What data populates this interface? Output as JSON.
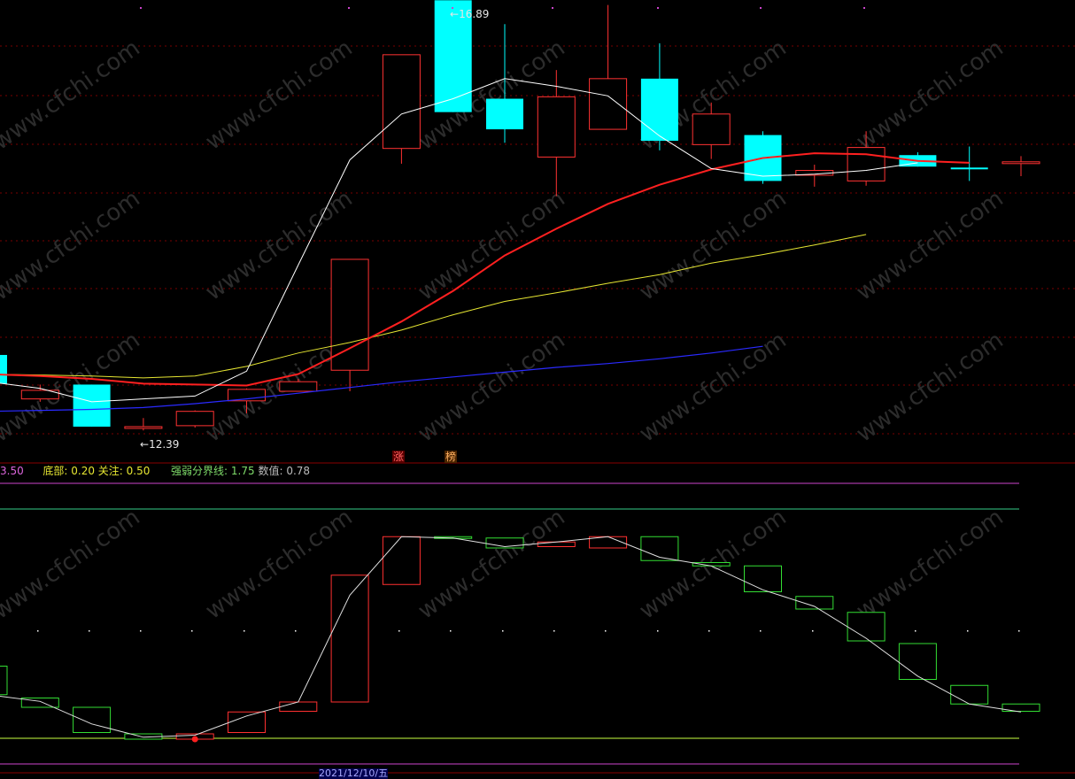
{
  "colors": {
    "background": "#000000",
    "grid": "#7a0000",
    "up": "#ff3232",
    "down": "#00ffff",
    "ma5": "#ffffff",
    "ma10": "#ff2020",
    "ma20": "#e6e632",
    "ma60": "#2a2aff",
    "osc_up": "#ff3030",
    "osc_down": "#33dd33",
    "line_pink": "#cc44cc",
    "line_green": "#33cc88",
    "line_yellow": "#c8ff40"
  },
  "price_panel": {
    "high_marker": "16.89",
    "low_marker": "12.39",
    "badge_zhang": "涨",
    "badge_bang": "榜"
  },
  "indicator_panel": {
    "partial_value": "3.50",
    "bottom_label": "底部:",
    "bottom_value": "0.20",
    "focus_label": "关注:",
    "focus_value": "0.50",
    "divider_label": "强弱分界线:",
    "divider_value": "1.75",
    "value_label": "数值:",
    "value_value": "0.78"
  },
  "date_label": "2021/12/10/五",
  "watermark": "www.cfchi.com",
  "chart_data": {
    "type": "candlestick",
    "candles": [
      {
        "o": 13.18,
        "h": 13.25,
        "l": 12.78,
        "c": 12.88
      },
      {
        "o": 12.72,
        "h": 12.87,
        "l": 12.69,
        "c": 12.81
      },
      {
        "o": 12.87,
        "h": 12.87,
        "l": 12.43,
        "c": 12.43
      },
      {
        "o": 12.43,
        "h": 12.52,
        "l": 12.39,
        "c": 12.43
      },
      {
        "o": 12.44,
        "h": 12.6,
        "l": 12.42,
        "c": 12.59
      },
      {
        "o": 12.7,
        "h": 12.83,
        "l": 12.57,
        "c": 12.82
      },
      {
        "o": 12.8,
        "h": 12.93,
        "l": 12.8,
        "c": 12.9
      },
      {
        "o": 13.02,
        "h": 14.18,
        "l": 12.8,
        "c": 14.18
      },
      {
        "o": 15.34,
        "h": 16.32,
        "l": 15.18,
        "c": 16.32
      },
      {
        "o": 16.89,
        "h": 16.89,
        "l": 15.72,
        "c": 15.72
      },
      {
        "o": 15.86,
        "h": 16.64,
        "l": 15.4,
        "c": 15.54
      },
      {
        "o": 15.25,
        "h": 16.16,
        "l": 14.84,
        "c": 15.88
      },
      {
        "o": 15.54,
        "h": 16.84,
        "l": 15.54,
        "c": 16.07
      },
      {
        "o": 16.07,
        "h": 16.44,
        "l": 15.32,
        "c": 15.42
      },
      {
        "o": 15.38,
        "h": 15.82,
        "l": 15.23,
        "c": 15.7
      },
      {
        "o": 15.48,
        "h": 15.52,
        "l": 14.97,
        "c": 15.0
      },
      {
        "o": 15.06,
        "h": 15.17,
        "l": 14.94,
        "c": 15.11
      },
      {
        "o": 15.0,
        "h": 15.52,
        "l": 14.95,
        "c": 15.35
      },
      {
        "o": 15.27,
        "h": 15.3,
        "l": 15.15,
        "c": 15.15
      },
      {
        "o": 15.14,
        "h": 15.36,
        "l": 15.0,
        "c": 15.13
      },
      {
        "o": 15.19,
        "h": 15.26,
        "l": 15.05,
        "c": 15.2
      }
    ],
    "ma5": [
      12.9,
      12.83,
      12.69,
      12.72,
      12.75,
      13.01,
      14.12,
      15.22,
      15.7,
      15.86,
      16.07,
      15.99,
      15.89,
      15.47,
      15.13,
      15.05,
      15.07,
      15.11,
      15.19
    ],
    "ma10": [
      12.98,
      12.96,
      12.93,
      12.88,
      12.87,
      12.86,
      12.98,
      13.25,
      13.53,
      13.85,
      14.22,
      14.5,
      14.76,
      14.96,
      15.12,
      15.24,
      15.29,
      15.28,
      15.21,
      15.19
    ],
    "ma20": [
      12.98,
      12.97,
      12.96,
      12.94,
      12.96,
      13.06,
      13.2,
      13.31,
      13.44,
      13.6,
      13.74,
      13.83,
      13.93,
      14.02,
      14.14,
      14.23,
      14.33,
      14.44
    ],
    "ma60": [
      12.59,
      12.6,
      12.61,
      12.63,
      12.67,
      12.72,
      12.78,
      12.84,
      12.9,
      12.95,
      13.0,
      13.05,
      13.09,
      13.14,
      13.2,
      13.27
    ],
    "oscillator": {
      "bars": [
        {
          "o": 1.55,
          "c": 1.12
        },
        {
          "o": 1.07,
          "c": 0.93
        },
        {
          "o": 0.93,
          "c": 0.55
        },
        {
          "o": 0.53,
          "c": 0.45
        },
        {
          "o": 0.45,
          "c": 0.53
        },
        {
          "o": 0.55,
          "c": 0.86
        },
        {
          "o": 0.87,
          "c": 1.01
        },
        {
          "o": 1.01,
          "c": 2.92
        },
        {
          "o": 2.78,
          "c": 3.5
        },
        {
          "o": 3.5,
          "c": 3.48
        },
        {
          "o": 3.48,
          "c": 3.33
        },
        {
          "o": 3.35,
          "c": 3.42
        },
        {
          "o": 3.33,
          "c": 3.5
        },
        {
          "o": 3.5,
          "c": 3.14
        },
        {
          "o": 3.11,
          "c": 3.06
        },
        {
          "o": 3.06,
          "c": 2.67
        },
        {
          "o": 2.6,
          "c": 2.41
        },
        {
          "o": 2.36,
          "c": 1.93
        },
        {
          "o": 1.89,
          "c": 1.35
        },
        {
          "o": 1.26,
          "c": 0.98
        },
        {
          "o": 0.98,
          "c": 0.87
        }
      ],
      "line": [
        1.12,
        1.02,
        0.68,
        0.48,
        0.51,
        0.8,
        1.01,
        2.62,
        3.5,
        3.48,
        3.35,
        3.42,
        3.5,
        3.19,
        3.06,
        2.7,
        2.45,
        1.97,
        1.4,
        0.98,
        0.86
      ],
      "levels": {
        "top": 3.5,
        "bottom": 0.2,
        "focus": 0.5,
        "divider": 1.75
      }
    }
  }
}
